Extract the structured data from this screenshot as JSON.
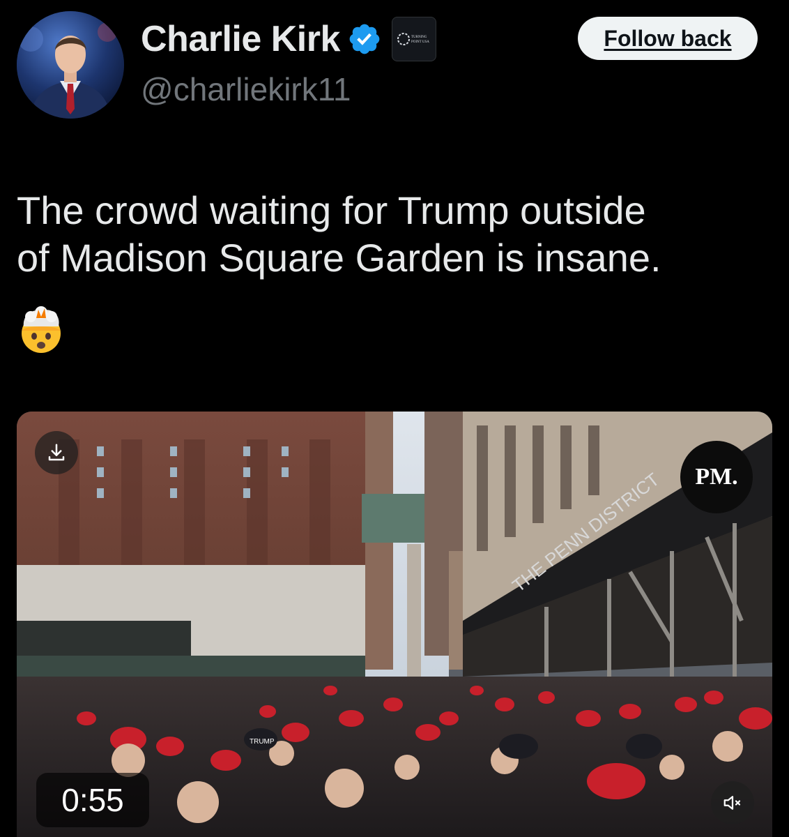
{
  "author": {
    "display_name": "Charlie Kirk",
    "handle": "@charliekirk11",
    "verified_icon": "verified-badge-icon",
    "affiliation_icon": "turning-point-usa-badge",
    "affiliation_text": "TURNING POINT USA"
  },
  "follow_button": {
    "label": "Follow back"
  },
  "tweet": {
    "text": "The crowd waiting for Trump outside\nof Madison Square Garden is insane.",
    "emoji": "🤯"
  },
  "video": {
    "timestamp": "0:55",
    "watermark": "PM.",
    "sign_text": "THE PENN DISTRICT",
    "hat_text": "TRUMP",
    "download_icon": "download-icon",
    "mute_icon": "speaker-muted-icon"
  },
  "colors": {
    "background": "#000000",
    "text_primary": "#e7e9ea",
    "text_secondary": "#71767b",
    "verified_blue": "#1d9bf0",
    "button_bg": "#eff3f4"
  }
}
